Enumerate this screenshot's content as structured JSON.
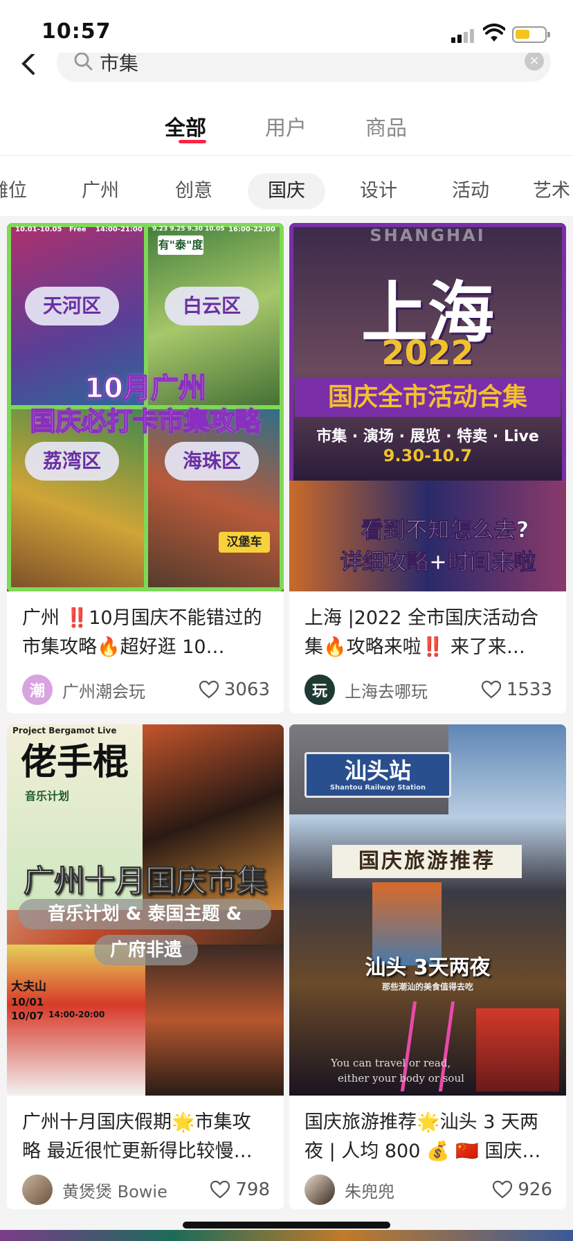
{
  "status": {
    "time": "10:57"
  },
  "search": {
    "query": "市集",
    "clear_label": "×"
  },
  "tabs": [
    {
      "label": "全部",
      "active": true
    },
    {
      "label": "用户",
      "active": false
    },
    {
      "label": "商品",
      "active": false
    }
  ],
  "chips": [
    {
      "label": "摊位"
    },
    {
      "label": "广州"
    },
    {
      "label": "创意"
    },
    {
      "label": "国庆",
      "active": true
    },
    {
      "label": "设计"
    },
    {
      "label": "活动"
    },
    {
      "label": "艺术"
    }
  ],
  "cards": [
    {
      "title": "广州 ‼️10月国庆不能错过的市集攻略🔥超好逛 10…",
      "author": "广州潮会玩",
      "avatar_text": "潮",
      "likes": "3063",
      "thumb": {
        "date_left": "10.01-10.05",
        "free": "Free",
        "time_left": "14:00-21:00",
        "date_right": "9.23 9.25 9.30 10.05",
        "time_right": "16:00-22:00",
        "sign": "有\"泰\"度",
        "districts": [
          "天河区",
          "白云区",
          "荔湾区",
          "海珠区"
        ],
        "headline_1": "10月广州",
        "headline_2": "国庆必打卡市集攻略",
        "sticker": "汉堡车"
      }
    },
    {
      "title": "上海 |2022 全市国庆活动合集🔥攻略来啦‼️ 来了来…",
      "author": "上海去哪玩",
      "avatar_text": "玩",
      "likes": "1533",
      "thumb": {
        "watermark": "SHANGHAI",
        "city": "上海",
        "year": "2022",
        "subtitle": "国庆全市活动合集",
        "categories": "市集 · 演场 · 展览 · 特卖 · Live",
        "dates": "9.30-10.7",
        "bottom_1": "看到不知怎么去?",
        "bottom_2": "详细攻略+时间来啦"
      }
    },
    {
      "title": "广州十月国庆假期🌟市集攻略 最近很忙更新得比较慢…",
      "author": "黄煲煲 Bowie",
      "avatar_text": "",
      "likes": "798",
      "thumb": {
        "project": "Project Bergamot Live",
        "poster_title": "佬手棍",
        "music_plan": "音乐计划",
        "headline": "广州十月国庆市集",
        "sub_1": "音乐计划 & 泰国主题 &",
        "sub_2": "广府非遗",
        "venue": "大夫山",
        "date_a": "10/01",
        "date_b": "10/07",
        "time": "14:00-20:00"
      }
    },
    {
      "title": "国庆旅游推荐🌟汕头 3 天两夜 | 人均 800 💰 🇨🇳 国庆…",
      "author": "朱兜兜",
      "avatar_text": "",
      "likes": "926",
      "thumb": {
        "station": "汕头站",
        "station_en": "Shantou Railway Station",
        "banner": "国庆旅游推荐",
        "trip": "汕头 3天两夜",
        "small_caption": "那些潮汕的美食值得去吃",
        "script_1": "You can travel or read,",
        "script_2": "either your body or soul"
      }
    }
  ],
  "colors": {
    "accent": "#ff2442",
    "purple": "#7a2ea8",
    "gold": "#f2c12e",
    "feed_bg": "#f4f4f4"
  }
}
